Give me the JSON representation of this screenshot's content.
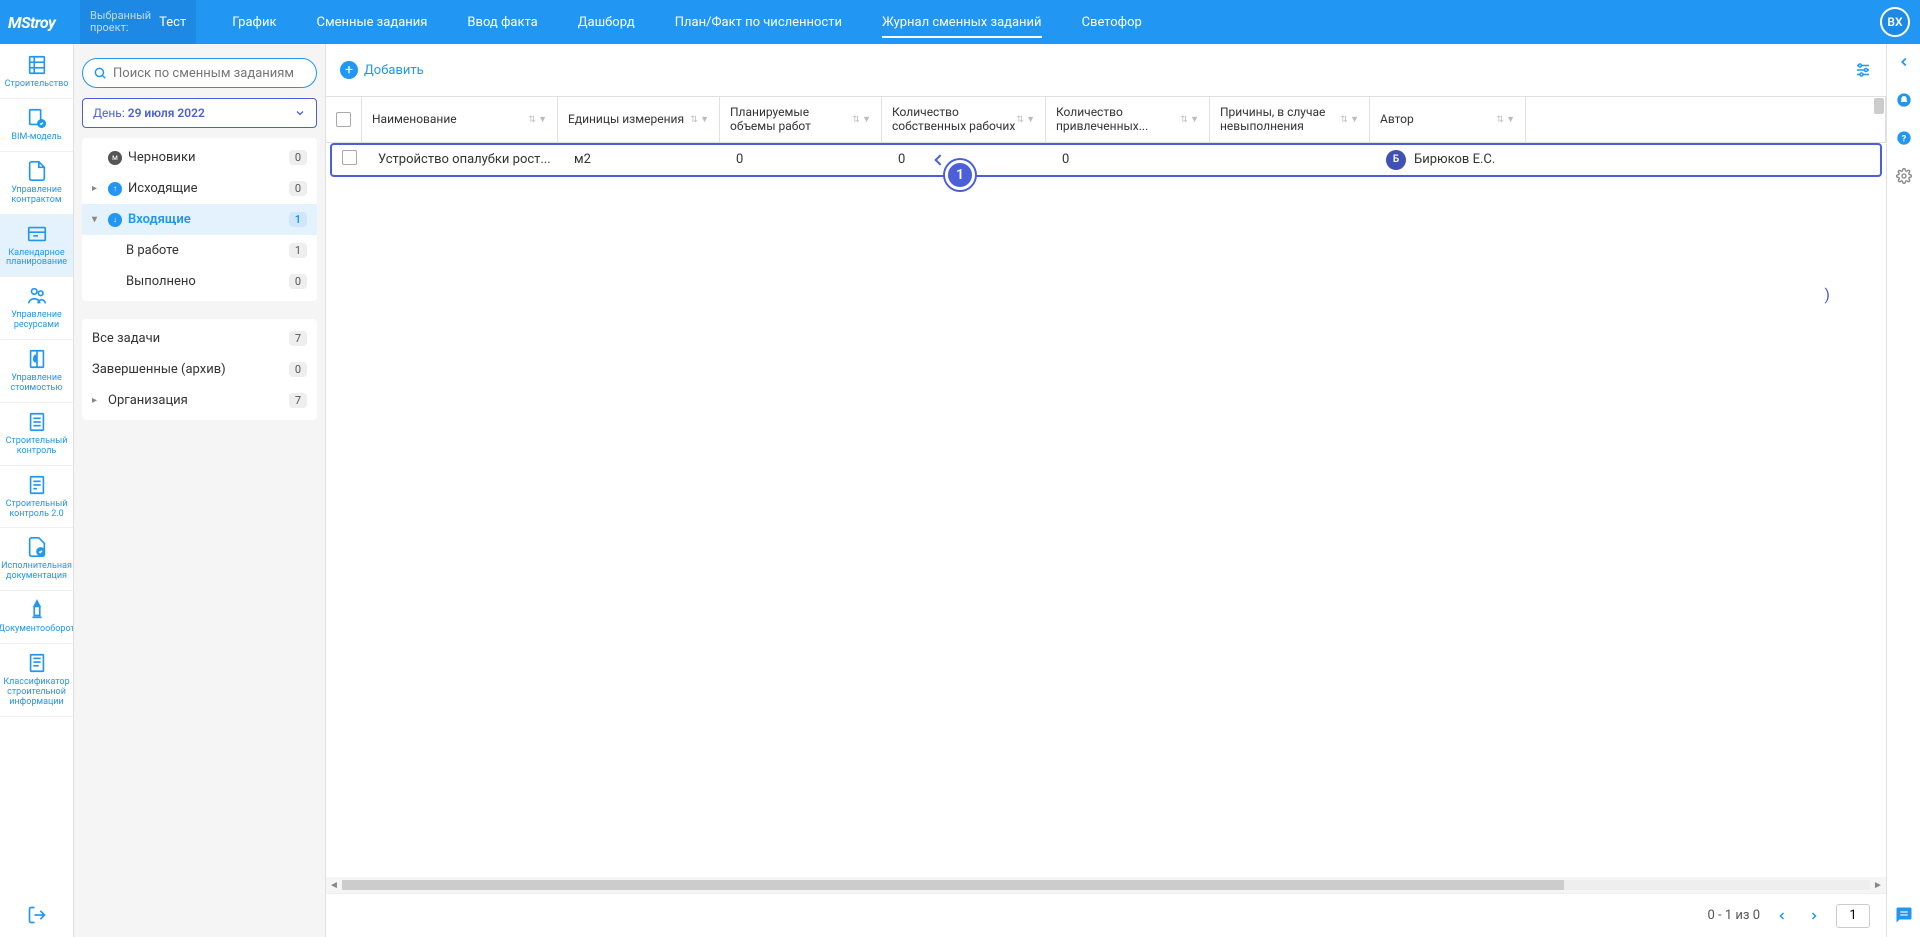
{
  "header": {
    "logo": "MStroy",
    "project_label": "Выбранный\nпроект:",
    "project_name": "Тест",
    "tabs": [
      "График",
      "Сменные задания",
      "Ввод факта",
      "Дашборд",
      "План/Факт по численности",
      "Журнал сменных заданий",
      "Светофор"
    ],
    "active_tab": 5,
    "avatar": "ВХ"
  },
  "leftRail": [
    {
      "label": "Строительство"
    },
    {
      "label": "BIM-модель"
    },
    {
      "label": "Управление контрактом"
    },
    {
      "label": "Календарное планирование",
      "active": true
    },
    {
      "label": "Управление ресурсами"
    },
    {
      "label": "Управление стоимостью"
    },
    {
      "label": "Строительный контроль"
    },
    {
      "label": "Строительный контроль 2.0"
    },
    {
      "label": "Исполнительная документация"
    },
    {
      "label": "Документооборот"
    },
    {
      "label": "Классификатор строительной информации"
    }
  ],
  "sidePanel": {
    "search_placeholder": "Поиск по сменным заданиям",
    "date_prefix": "День:",
    "date_value": "29 июля 2022",
    "tree1": [
      {
        "icon_bg": "#555",
        "icon_txt": "м",
        "label": "Черновики",
        "count": "0",
        "type": "leaf"
      },
      {
        "icon_bg": "#2196f3",
        "icon_txt": "↑",
        "label": "Исходящие",
        "count": "0",
        "type": "branch",
        "expanded": false
      },
      {
        "icon_bg": "#2196f3",
        "icon_txt": "↓",
        "label": "Входящие",
        "count": "1",
        "type": "branch",
        "expanded": true,
        "active": true
      },
      {
        "label": "В работе",
        "count": "1",
        "type": "sub"
      },
      {
        "label": "Выполнено",
        "count": "0",
        "type": "sub"
      }
    ],
    "tree2": [
      {
        "label": "Все задачи",
        "count": "7",
        "type": "leaf"
      },
      {
        "label": "Завершенные (архив)",
        "count": "0",
        "type": "leaf"
      },
      {
        "label": "Организация",
        "count": "7",
        "type": "branch",
        "expanded": false
      }
    ]
  },
  "toolbar": {
    "add_label": "Добавить"
  },
  "grid": {
    "columns": [
      "Наименование",
      "Единицы измерения",
      "Планируемые объемы работ",
      "Количество собственных рабочих",
      "Количество привлеченных...",
      "Причины, в случае невыполнения",
      "Автор"
    ],
    "rows": [
      {
        "name": "Устройство опалубки рост...",
        "unit": "м2",
        "plan": "0",
        "own": "0",
        "attr": "0",
        "reason": "",
        "author_initial": "Б",
        "author": "Бирюков Е.С."
      }
    ]
  },
  "pager": {
    "summary": "0 - 1 из 0",
    "page": "1"
  },
  "stepIndicator": "1"
}
